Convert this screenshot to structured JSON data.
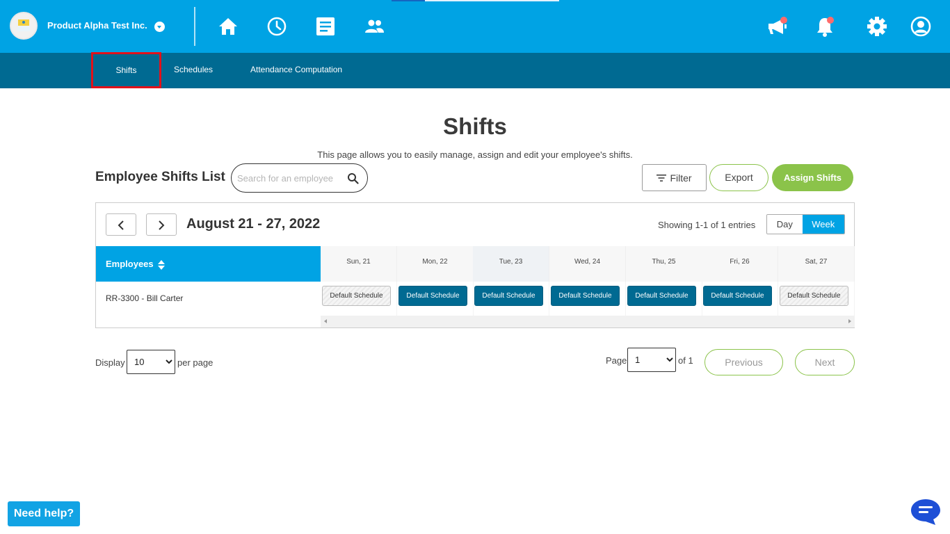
{
  "header": {
    "company_name": "Product Alpha Test Inc.",
    "nav_icons": [
      "home-icon",
      "clock-icon",
      "document-icon",
      "people-icon"
    ],
    "right_icons": [
      "megaphone-icon",
      "bell-icon",
      "gear-icon",
      "user-icon"
    ],
    "colors": {
      "primary": "#00a3e4",
      "secondary": "#006a92",
      "accent_green": "#8bc34a",
      "highlight_red": "#e2111a"
    }
  },
  "subnav": {
    "tabs": [
      {
        "label": "Shifts",
        "active": true
      },
      {
        "label": "Schedules",
        "active": false
      },
      {
        "label": "Attendance Computation",
        "active": false
      }
    ]
  },
  "page": {
    "title": "Shifts",
    "subtitle": "This page allows you to easily manage, assign and edit your employee's shifts.",
    "list_title": "Employee Shifts List"
  },
  "search": {
    "placeholder": "Search for an employee",
    "value": ""
  },
  "toolbar": {
    "filter_label": "Filter",
    "export_label": "Export",
    "assign_label": "Assign Shifts"
  },
  "calendar": {
    "range_label": "August 21 - 27, 2022",
    "showing_text": "Showing 1-1 of 1 entries",
    "view_day": "Day",
    "view_week": "Week",
    "employees_header": "Employees",
    "days": [
      "Sun, 21",
      "Mon, 22",
      "Tue, 23",
      "Wed, 24",
      "Thu, 25",
      "Fri, 26",
      "Sat, 27"
    ],
    "rows": [
      {
        "employee": "RR-3300 - Bill Carter",
        "shifts": [
          {
            "label": "Default Schedule",
            "style": "off"
          },
          {
            "label": "Default Schedule",
            "style": "blue"
          },
          {
            "label": "Default Schedule",
            "style": "blue"
          },
          {
            "label": "Default Schedule",
            "style": "blue"
          },
          {
            "label": "Default Schedule",
            "style": "blue"
          },
          {
            "label": "Default Schedule",
            "style": "blue"
          },
          {
            "label": "Default Schedule",
            "style": "off"
          }
        ]
      }
    ]
  },
  "pagination": {
    "display_label": "Display",
    "per_page_value": "10",
    "per_page_label": "per page",
    "page_label": "Page",
    "page_value": "1",
    "of_label": "of 1",
    "previous_label": "Previous",
    "next_label": "Next"
  },
  "help": {
    "label": "Need help?"
  }
}
